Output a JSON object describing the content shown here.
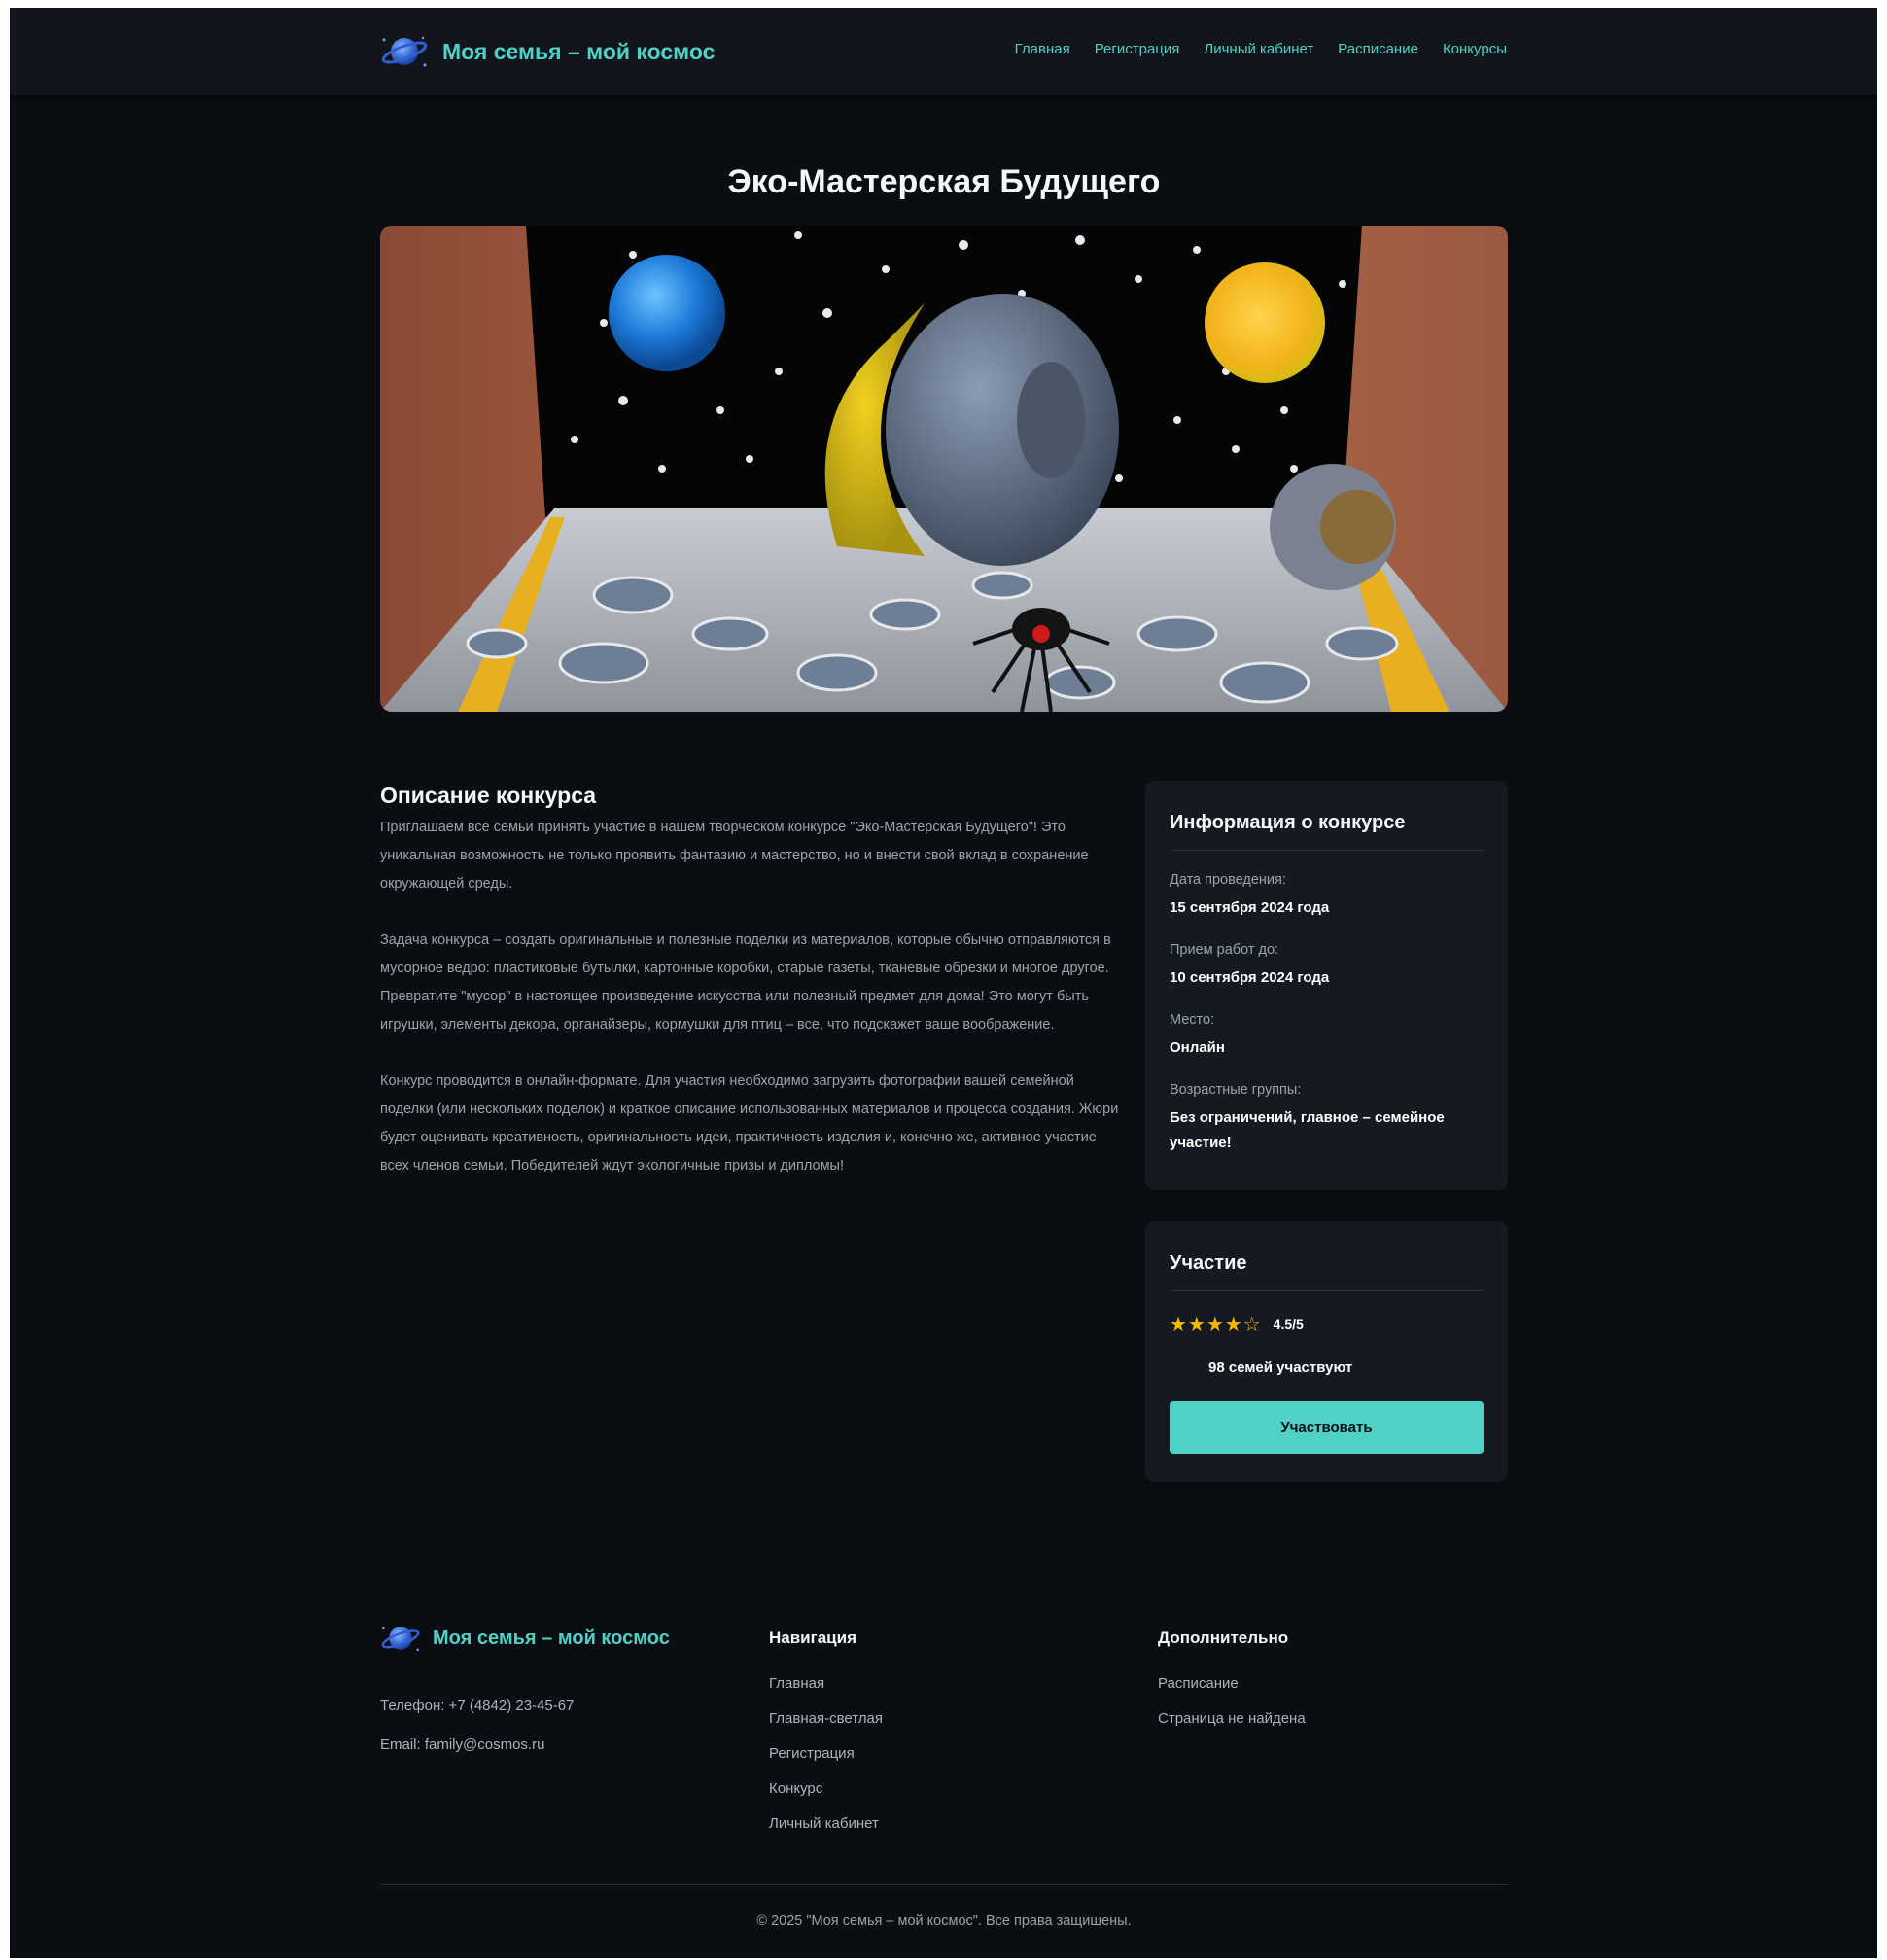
{
  "header": {
    "brand": "Моя семья – мой космос",
    "logo_icon": "planet-icon",
    "nav": [
      "Главная",
      "Регистрация",
      "Личный кабинет",
      "Расписание",
      "Конкурсы"
    ]
  },
  "main": {
    "title": "Эко-Мастерская Будущего",
    "description": {
      "heading": "Описание конкурса",
      "paragraphs": [
        "Приглашаем все семьи принять участие в нашем творческом конкурсе \"Эко-Мастерская Будущего\"! Это уникальная возможность не только проявить фантазию и мастерство, но и внести свой вклад в сохранение окружающей среды.",
        "Задача конкурса – создать оригинальные и полезные поделки из материалов, которые обычно отправляются в мусорное ведро: пластиковые бутылки, картонные коробки, старые газеты, тканевые обрезки и многое другое. Превратите \"мусор\" в настоящее произведение искусства или полезный предмет для дома! Это могут быть игрушки, элементы декора, органайзеры, кормушки для птиц – все, что подскажет ваше воображение.",
        "Конкурс проводится в онлайн-формате. Для участия необходимо загрузить фотографии вашей семейной поделки (или нескольких поделок) и краткое описание использованных материалов и процесса создания. Жюри будет оценивать креативность, оригинальность идеи, практичность изделия и, конечно же, активное участие всех членов семьи. Победителей ждут экологичные призы и дипломы!"
      ]
    },
    "info_card": {
      "title": "Информация о конкурсе",
      "items": [
        {
          "label": "Дата проведения:",
          "value": "15 сентября 2024 года"
        },
        {
          "label": "Прием работ до:",
          "value": "10 сентября 2024 года"
        },
        {
          "label": "Место:",
          "value": "Онлайн"
        },
        {
          "label": "Возрастные группы:",
          "value": "Без ограничений, главное – семейное участие!"
        }
      ]
    },
    "participation_card": {
      "title": "Участие",
      "rating": 4.5,
      "stars": "★★★★☆",
      "rating_text": "4.5/5",
      "participants": "98 семей участвуют",
      "button": "Участвовать"
    }
  },
  "footer": {
    "brand": "Моя семья – мой космос",
    "phone": "Телефон: +7 (4842) 23-45-67",
    "email": "Email: family@cosmos.ru",
    "nav_heading": "Навигация",
    "nav_links": [
      "Главная",
      "Главная-светлая",
      "Регистрация",
      "Конкурс",
      "Личный кабинет"
    ],
    "extra_heading": "Дополнительно",
    "extra_links": [
      "Расписание",
      "Страница не найдена"
    ],
    "copyright": "© 2025 \"Моя семья – мой космос\". Все права защищены."
  },
  "colors": {
    "accent": "#4fd1c5",
    "background": "#0a0e13",
    "card": "#151a22",
    "star": "#f5b800"
  }
}
